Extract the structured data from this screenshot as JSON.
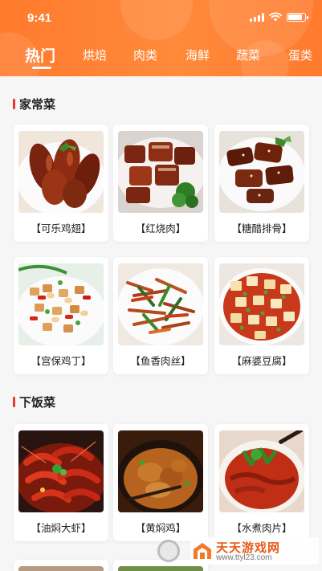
{
  "status_bar": {
    "time": "9:41",
    "battery_level": 0.85,
    "icons": [
      "cellular-signal-icon",
      "wifi-icon",
      "battery-icon"
    ]
  },
  "tabs": [
    "热门",
    "烘焙",
    "肉类",
    "海鲜",
    "蔬菜",
    "蛋类"
  ],
  "active_tab": "热门",
  "sections": [
    {
      "title": "家常菜",
      "dishes": [
        "【可乐鸡翅】",
        "【红烧肉】",
        "【糖醋排骨】",
        "【宫保鸡丁】",
        "【鱼香肉丝】",
        "【麻婆豆腐】"
      ]
    },
    {
      "title": "下饭菜",
      "dishes": [
        "【油焖大虾】",
        "【黄焖鸡】",
        "【水煮肉片】"
      ]
    }
  ],
  "watermark": {
    "title": "天天游戏网",
    "url": "www.ttyl23.com"
  },
  "colors": {
    "header_orange": "#ff7a2d",
    "section_marker_red": "#e83a2a",
    "background": "#f6f6f6",
    "card": "#ffffff"
  }
}
